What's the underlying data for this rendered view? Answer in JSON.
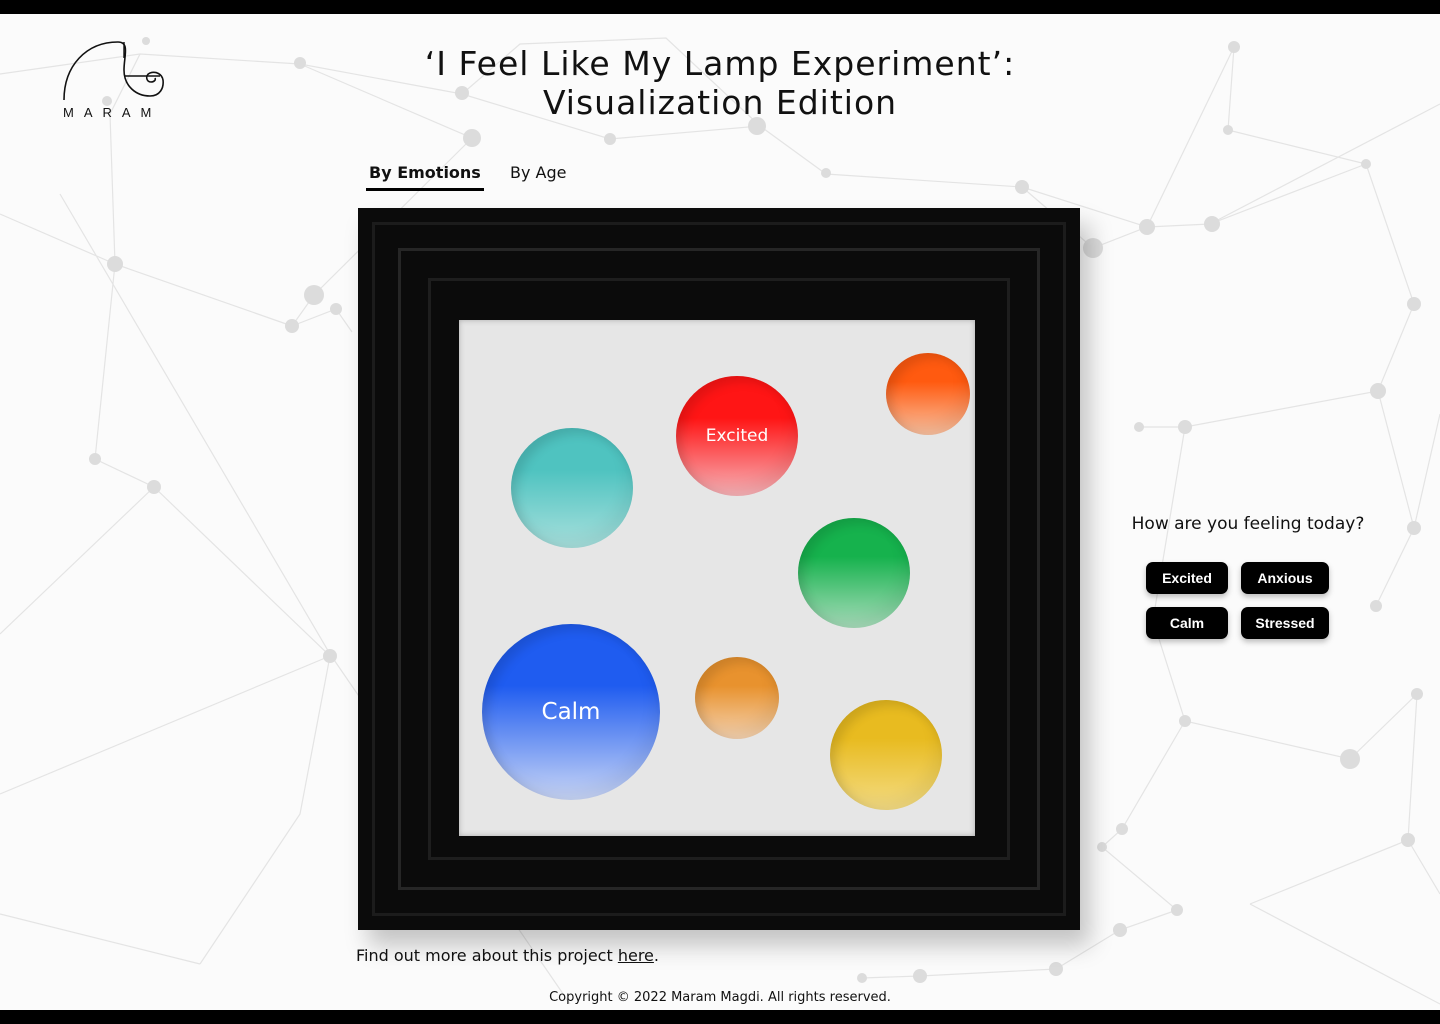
{
  "brand": {
    "logo_text": "MARAM"
  },
  "page": {
    "title_line1": "‘I Feel Like My Lamp Experiment’:",
    "title_line2": "Visualization Edition"
  },
  "tabs": [
    {
      "label": "By Emotions",
      "active": true
    },
    {
      "label": "By Age",
      "active": false
    }
  ],
  "visualization": {
    "bubbles": [
      {
        "label": "",
        "color_top": "#4fc3c0",
        "color_bottom": "#a8e0dd"
      },
      {
        "label": "Excited",
        "color_top": "#ff1515",
        "color_bottom": "#f7b3b8"
      },
      {
        "label": "",
        "color_top": "#ff5a10",
        "color_bottom": "#f9c1a0"
      },
      {
        "label": "",
        "color_top": "#16b24d",
        "color_bottom": "#a8dcbb"
      },
      {
        "label": "Calm",
        "color_top": "#1f5cf0",
        "color_bottom": "#c9d6f6"
      },
      {
        "label": "",
        "color_top": "#e8922e",
        "color_bottom": "#f4d2b0"
      },
      {
        "label": "",
        "color_top": "#e8bb20",
        "color_bottom": "#f4dc84"
      }
    ]
  },
  "feeling_panel": {
    "question": "How are you feeling today?",
    "buttons": [
      "Excited",
      "Anxious",
      "Calm",
      "Stressed"
    ]
  },
  "footer": {
    "more_text": "Find out more about this project",
    "more_link": "here",
    "more_period": ".",
    "copyright": "Copyright © 2022 Maram Magdi. All rights reserved."
  }
}
